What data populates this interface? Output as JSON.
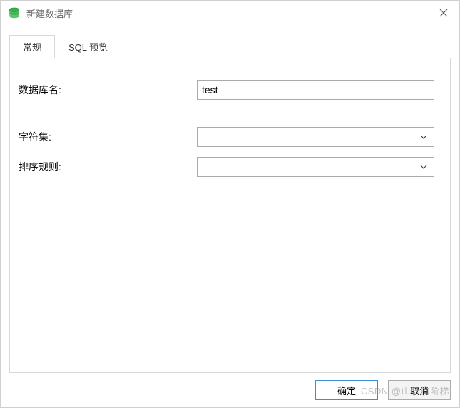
{
  "window": {
    "title": "新建数据库"
  },
  "tabs": {
    "general": "常规",
    "sql_preview": "SQL 预览"
  },
  "form": {
    "database_name_label": "数据库名:",
    "database_name_value": "test",
    "charset_label": "字符集:",
    "charset_value": "",
    "collation_label": "排序规则:",
    "collation_value": ""
  },
  "buttons": {
    "ok": "确定",
    "cancel": "取消"
  },
  "watermark": "CSDN @山妖的阶梯"
}
